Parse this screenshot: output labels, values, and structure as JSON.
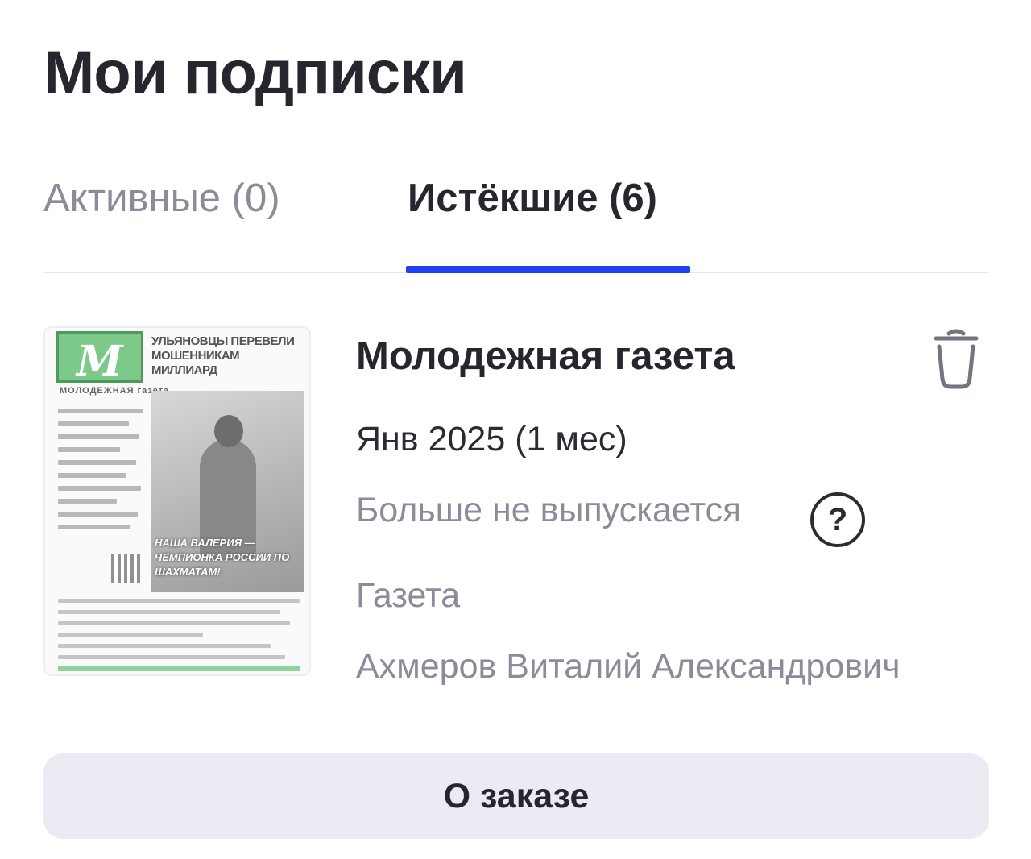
{
  "page": {
    "title": "Мои подписки"
  },
  "tabs": [
    {
      "label": "Активные (0)",
      "active": false
    },
    {
      "label": "Истёкшие (6)",
      "active": true
    }
  ],
  "colors": {
    "accent": "#1f3ff0",
    "muted_text": "#8a8d99",
    "button_bg": "#ebebf3"
  },
  "subscription": {
    "title": "Молодежная газета",
    "period": "Янв 2025 (1 мес)",
    "status": "Больше не выпускается",
    "type": "Газета",
    "recipient": "Ахмеров Виталий Александрович",
    "icons": {
      "delete": "trash-icon",
      "help": "question-circle-icon"
    },
    "cover": {
      "headline": "УЛЬЯНОВЦЫ ПЕРЕВЕЛИ МОШЕННИКАМ МИЛЛИАРД",
      "masthead": "МОЛОДЕЖНАЯ газета",
      "banner": "НАША ВАЛЕРИЯ — ЧЕМПИОНКА РОССИИ ПО ШАХМАТАМ!"
    }
  },
  "order_button": {
    "label": "О заказе"
  }
}
